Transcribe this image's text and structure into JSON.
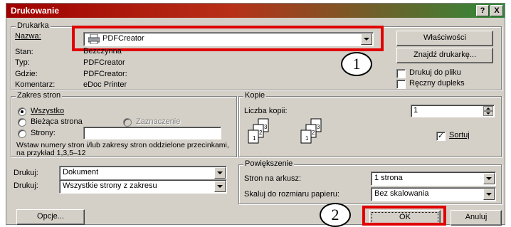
{
  "window": {
    "title": "Drukowanie",
    "help_btn": "?",
    "close_btn": "X"
  },
  "printer": {
    "group_label": "Drukarka",
    "name_label": "Nazwa:",
    "name_value": "PDFCreator",
    "status_label": "Stan:",
    "status_value": "Bezczynna",
    "type_label": "Typ:",
    "type_value": "PDFCreator",
    "where_label": "Gdzie:",
    "where_value": "PDFCreator:",
    "comment_label": "Komentarz:",
    "comment_value": "eDoc Printer",
    "properties_btn": "Właściwości",
    "find_btn": "Znajdź drukarkę...",
    "print_to_file": "Drukuj do pliku",
    "manual_duplex": "Ręczny dupleks"
  },
  "range": {
    "group_label": "Zakres stron",
    "all": "Wszystko",
    "current": "Bieżąca strona",
    "selection": "Zaznaczenie",
    "pages": "Strony:",
    "pages_value": "",
    "hint": "Wstaw numery stron i/lub zakresy stron oddzielone przecinkami, na przykład 1,3,5–12"
  },
  "copies": {
    "group_label": "Kopie",
    "count_label": "Liczba kopii:",
    "count_value": "1",
    "collate": "Sortuj",
    "collate_checked": "✓"
  },
  "print_what": {
    "label1": "Drukuj:",
    "value1": "Dokument",
    "label2": "Drukuj:",
    "value2": "Wszystkie strony z zakresu"
  },
  "zoom": {
    "group_label": "Powiększenie",
    "pages_per_sheet_label": "Stron na arkusz:",
    "pages_per_sheet_value": "1 strona",
    "scale_label": "Skaluj do rozmiaru papieru:",
    "scale_value": "Bez skalowania"
  },
  "footer": {
    "options_btn": "Opcje...",
    "ok_btn": "OK",
    "cancel_btn": "Anuluj"
  },
  "callouts": {
    "one": "1",
    "two": "2"
  },
  "colors": {
    "highlight": "#e00000",
    "face": "#d4d0c8"
  }
}
